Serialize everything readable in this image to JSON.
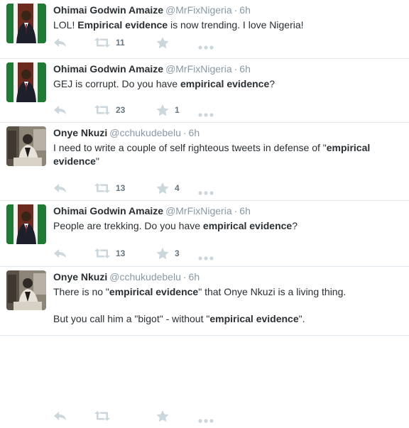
{
  "tweets": [
    {
      "author": "Ohimai Godwin Amaize",
      "handle": "@MrFixNigeria",
      "time": "6h",
      "avatar": "avatar-suited-man",
      "paragraphs": [
        [
          {
            "t": "LOL! ",
            "b": false
          },
          {
            "t": "Empirical evidence",
            "b": true
          },
          {
            "t": " is now trending. I love Nigeria!",
            "b": false
          }
        ]
      ],
      "retweets": "11",
      "likes": ""
    },
    {
      "author": "Ohimai Godwin Amaize",
      "handle": "@MrFixNigeria",
      "time": "6h",
      "avatar": "avatar-suited-man",
      "paragraphs": [
        [
          {
            "t": "GEJ is corrupt. Do you have ",
            "b": false
          },
          {
            "t": "empirical evidence",
            "b": true
          },
          {
            "t": "?",
            "b": false
          }
        ]
      ],
      "retweets": "23",
      "likes": "1"
    },
    {
      "author": "Onye Nkuzi",
      "handle": "@cchukudebelu",
      "time": "6h",
      "avatar": "avatar-seated-man",
      "paragraphs": [
        [
          {
            "t": "I need to write a couple of self righteous tweets in defense of \"",
            "b": false
          },
          {
            "t": "empirical evidence",
            "b": true
          },
          {
            "t": "\"",
            "b": false
          }
        ]
      ],
      "retweets": "13",
      "likes": "4"
    },
    {
      "author": "Ohimai Godwin Amaize",
      "handle": "@MrFixNigeria",
      "time": "6h",
      "avatar": "avatar-suited-man",
      "paragraphs": [
        [
          {
            "t": "People are trekking. Do you have ",
            "b": false
          },
          {
            "t": "empirical evidence",
            "b": true
          },
          {
            "t": "?",
            "b": false
          }
        ]
      ],
      "retweets": "13",
      "likes": "3"
    },
    {
      "author": "Onye Nkuzi",
      "handle": "@cchukudebelu",
      "time": "6h",
      "avatar": "avatar-seated-man",
      "paragraphs": [
        [
          {
            "t": "There is no \"",
            "b": false
          },
          {
            "t": "empirical evidence",
            "b": true
          },
          {
            "t": "\" that Onye Nkuzi is a living thing.",
            "b": false
          }
        ],
        [
          {
            "t": "But you call him a \"bigot\" - without \"",
            "b": false
          },
          {
            "t": "empirical evidence",
            "b": true
          },
          {
            "t": "\".",
            "b": false
          }
        ]
      ],
      "retweets": "",
      "likes": ""
    }
  ],
  "separator": "·",
  "icons": {
    "reply": "reply-arrow-icon",
    "retweet": "retweet-icon",
    "like": "star-icon",
    "more": "more-dots-icon"
  },
  "colors": {
    "name": "#292f33",
    "meta": "#8899a6",
    "icon": "#ccd6dd",
    "count": "#66757f",
    "divider": "#e1e8ed"
  }
}
